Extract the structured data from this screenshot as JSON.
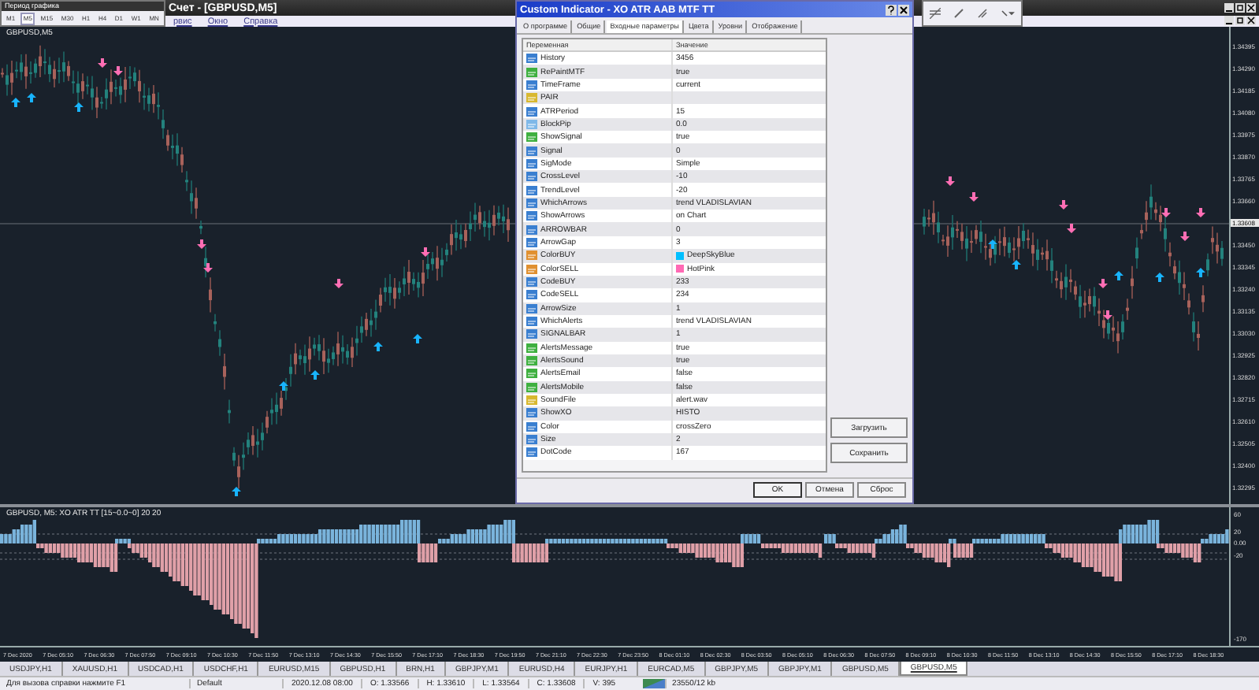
{
  "window": {
    "title": "Счет - [GBPUSD,M5]"
  },
  "menu": [
    "рвис",
    "Окно",
    "Справка"
  ],
  "timeframe_toolbar": {
    "title": "Период графика",
    "buttons": [
      {
        "label": "M1",
        "selected": false
      },
      {
        "label": "M5",
        "selected": true
      },
      {
        "label": "M15",
        "selected": false
      },
      {
        "label": "M30",
        "selected": false
      },
      {
        "label": "H1",
        "selected": false
      },
      {
        "label": "H4",
        "selected": false
      },
      {
        "label": "D1",
        "selected": false
      },
      {
        "label": "W1",
        "selected": false
      },
      {
        "label": "MN",
        "selected": false
      }
    ]
  },
  "chart": {
    "symbol_label": "GBPUSD,M5",
    "current_price": "1.33608",
    "price_axis": [
      "1.34395",
      "1.34290",
      "1.34185",
      "1.34080",
      "1.33975",
      "1.33870",
      "1.33765",
      "1.33660",
      "1.33450",
      "1.33345",
      "1.33240",
      "1.33135",
      "1.33030",
      "1.32925",
      "1.32820",
      "1.32715",
      "1.32610",
      "1.32505",
      "1.32400",
      "1.32295"
    ]
  },
  "indicator_window": {
    "label": "GBPUSD, M5: XO ATR TT [15~0.0~0] 20 20",
    "axis": [
      "60",
      "20",
      "0.00",
      "-20",
      "-170"
    ]
  },
  "time_axis": [
    "7 Dec 2020",
    "7 Dec 05:10",
    "7 Dec 06:30",
    "7 Dec 07:50",
    "7 Dec 09:10",
    "7 Dec 10:30",
    "7 Dec 11:50",
    "7 Dec 13:10",
    "7 Dec 14:30",
    "7 Dec 15:50",
    "7 Dec 17:10",
    "7 Dec 18:30",
    "7 Dec 19:50",
    "7 Dec 21:10",
    "7 Dec 22:30",
    "7 Dec 23:50",
    "8 Dec 01:10",
    "8 Dec 02:30",
    "8 Dec 03:50",
    "8 Dec 05:10",
    "8 Dec 06:30",
    "8 Dec 07:50",
    "8 Dec 09:10",
    "8 Dec 10:30",
    "8 Dec 11:50",
    "8 Dec 13:10",
    "8 Dec 14:30",
    "8 Dec 15:50",
    "8 Dec 17:10",
    "8 Dec 18:30"
  ],
  "tabs": [
    {
      "label": "USDJPY,H1",
      "selected": false
    },
    {
      "label": "XAUUSD,H1",
      "selected": false
    },
    {
      "label": "USDCAD,H1",
      "selected": false
    },
    {
      "label": "USDCHF,H1",
      "selected": false
    },
    {
      "label": "EURUSD,M15",
      "selected": false
    },
    {
      "label": "GBPUSD,H1",
      "selected": false
    },
    {
      "label": "BRN,H1",
      "selected": false
    },
    {
      "label": "GBPJPY,M1",
      "selected": false
    },
    {
      "label": "EURUSD,H4",
      "selected": false
    },
    {
      "label": "EURJPY,H1",
      "selected": false
    },
    {
      "label": "EURCAD,M5",
      "selected": false
    },
    {
      "label": "GBPJPY,M5",
      "selected": false
    },
    {
      "label": "GBPJPY,M1",
      "selected": false
    },
    {
      "label": "GBPUSD,M5",
      "selected": false
    },
    {
      "label": "GBPUSD,M5",
      "selected": true
    }
  ],
  "status_bar": {
    "help": "Для вызова справки нажмите F1",
    "profile": "Default",
    "fields": [
      "2020.12.08 08:00",
      "O: 1.33566",
      "H: 1.33610",
      "L: 1.33564",
      "C: 1.33608",
      "V: 395"
    ],
    "traffic": "23550/12 kb"
  },
  "dialog": {
    "title": "Custom Indicator - XO ATR AAB MTF TT",
    "tabs": [
      {
        "label": "О программе",
        "selected": false
      },
      {
        "label": "Общие",
        "selected": false
      },
      {
        "label": "Входные параметры",
        "selected": true
      },
      {
        "label": "Цвета",
        "selected": false
      },
      {
        "label": "Уровни",
        "selected": false
      },
      {
        "label": "Отображение",
        "selected": false
      }
    ],
    "columns": [
      "Переменная",
      "Значение"
    ],
    "rows": [
      {
        "name": "History",
        "value": "3456",
        "kind": "int"
      },
      {
        "name": "RePaintMTF",
        "value": "true",
        "kind": "bool"
      },
      {
        "name": "TimeFrame",
        "value": "current",
        "kind": "int"
      },
      {
        "name": "PAIR",
        "kind": "string"
      },
      {
        "name": "ATRPeriod",
        "value": "15",
        "kind": "int"
      },
      {
        "name": "BlockPip",
        "value": "0.0",
        "kind": "double"
      },
      {
        "name": "ShowSignal",
        "value": "true",
        "kind": "bool"
      },
      {
        "name": "Signal",
        "value": "0",
        "kind": "int"
      },
      {
        "name": "SigMode",
        "value": "Simple",
        "kind": "int"
      },
      {
        "name": "CrossLevel",
        "value": "-10",
        "kind": "int"
      },
      {
        "name": "TrendLevel",
        "value": "-20",
        "kind": "int"
      },
      {
        "name": "WhichArrows",
        "value": "trend VLADISLAVIAN",
        "kind": "int"
      },
      {
        "name": "ShowArrows",
        "value": "on Chart",
        "kind": "int"
      },
      {
        "name": "ARROWBAR",
        "value": "0",
        "kind": "int"
      },
      {
        "name": "ArrowGap",
        "value": "3",
        "kind": "int"
      },
      {
        "name": "ColorBUY",
        "value": "DeepSkyBlue",
        "kind": "color",
        "color": "#00bfff"
      },
      {
        "name": "ColorSELL",
        "value": "HotPink",
        "kind": "color",
        "color": "#ff69b4"
      },
      {
        "name": "CodeBUY",
        "value": "233",
        "kind": "int"
      },
      {
        "name": "CodeSELL",
        "value": "234",
        "kind": "int"
      },
      {
        "name": "ArrowSize",
        "value": "1",
        "kind": "int"
      },
      {
        "name": "WhichAlerts",
        "value": "trend VLADISLAVIAN",
        "kind": "int"
      },
      {
        "name": "SIGNALBAR",
        "value": "1",
        "kind": "int"
      },
      {
        "name": "AlertsMessage",
        "value": "true",
        "kind": "bool"
      },
      {
        "name": "AlertsSound",
        "value": "true",
        "kind": "bool"
      },
      {
        "name": "AlertsEmail",
        "value": "false",
        "kind": "bool"
      },
      {
        "name": "AlertsMobile",
        "value": "false",
        "kind": "bool"
      },
      {
        "name": "SoundFile",
        "value": "alert.wav",
        "kind": "string"
      },
      {
        "name": "ShowXO",
        "value": "HISTO",
        "kind": "int"
      },
      {
        "name": "Color",
        "value": "crossZero",
        "kind": "int"
      },
      {
        "name": "Size",
        "value": "2",
        "kind": "int"
      },
      {
        "name": "DotCode",
        "value": "167",
        "kind": "int"
      }
    ],
    "side_buttons": [
      "Загрузить",
      "Сохранить"
    ],
    "buttons": [
      "OK",
      "Отмена",
      "Сброс"
    ]
  }
}
